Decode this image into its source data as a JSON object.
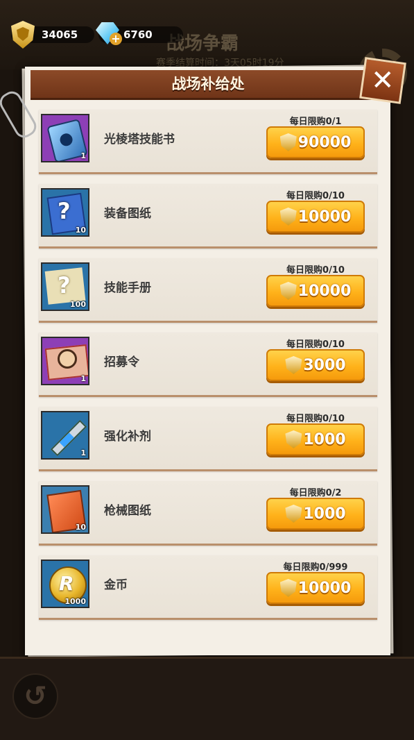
{
  "currency": {
    "medals": "34065",
    "gems": "6760",
    "plus_symbol": "+"
  },
  "background": {
    "event_title": "战场争霸",
    "event_subtitle": "赛季结算时间：3天05时19分"
  },
  "panel": {
    "title": "战场补给处",
    "close_symbol": "✕"
  },
  "items": [
    {
      "name": "光棱塔技能书",
      "count": "1",
      "limit": "每日限购0/1",
      "price": "90000",
      "icon": "blue-skill-book-icon"
    },
    {
      "name": "装备图纸",
      "count": "10",
      "limit": "每日限购0/10",
      "price": "10000",
      "icon": "equipment-blueprint-icon"
    },
    {
      "name": "技能手册",
      "count": "100",
      "limit": "每日限购0/10",
      "price": "10000",
      "icon": "skill-manual-icon"
    },
    {
      "name": "招募令",
      "count": "1",
      "limit": "每日限购0/10",
      "price": "3000",
      "icon": "recruit-order-icon"
    },
    {
      "name": "强化补剂",
      "count": "1",
      "limit": "每日限购0/10",
      "price": "1000",
      "icon": "syringe-icon"
    },
    {
      "name": "枪械图纸",
      "count": "10",
      "limit": "每日限购0/2",
      "price": "1000",
      "icon": "gun-blueprint-icon"
    },
    {
      "name": "金币",
      "count": "1000",
      "limit": "每日限购0/999",
      "price": "10000",
      "icon": "gold-coin-icon"
    }
  ],
  "back": {
    "symbol": "↺"
  },
  "colors": {
    "button_orange": "#ffb21a",
    "header_brown": "#7c3a1a",
    "panel_paper": "#f4efe6"
  }
}
